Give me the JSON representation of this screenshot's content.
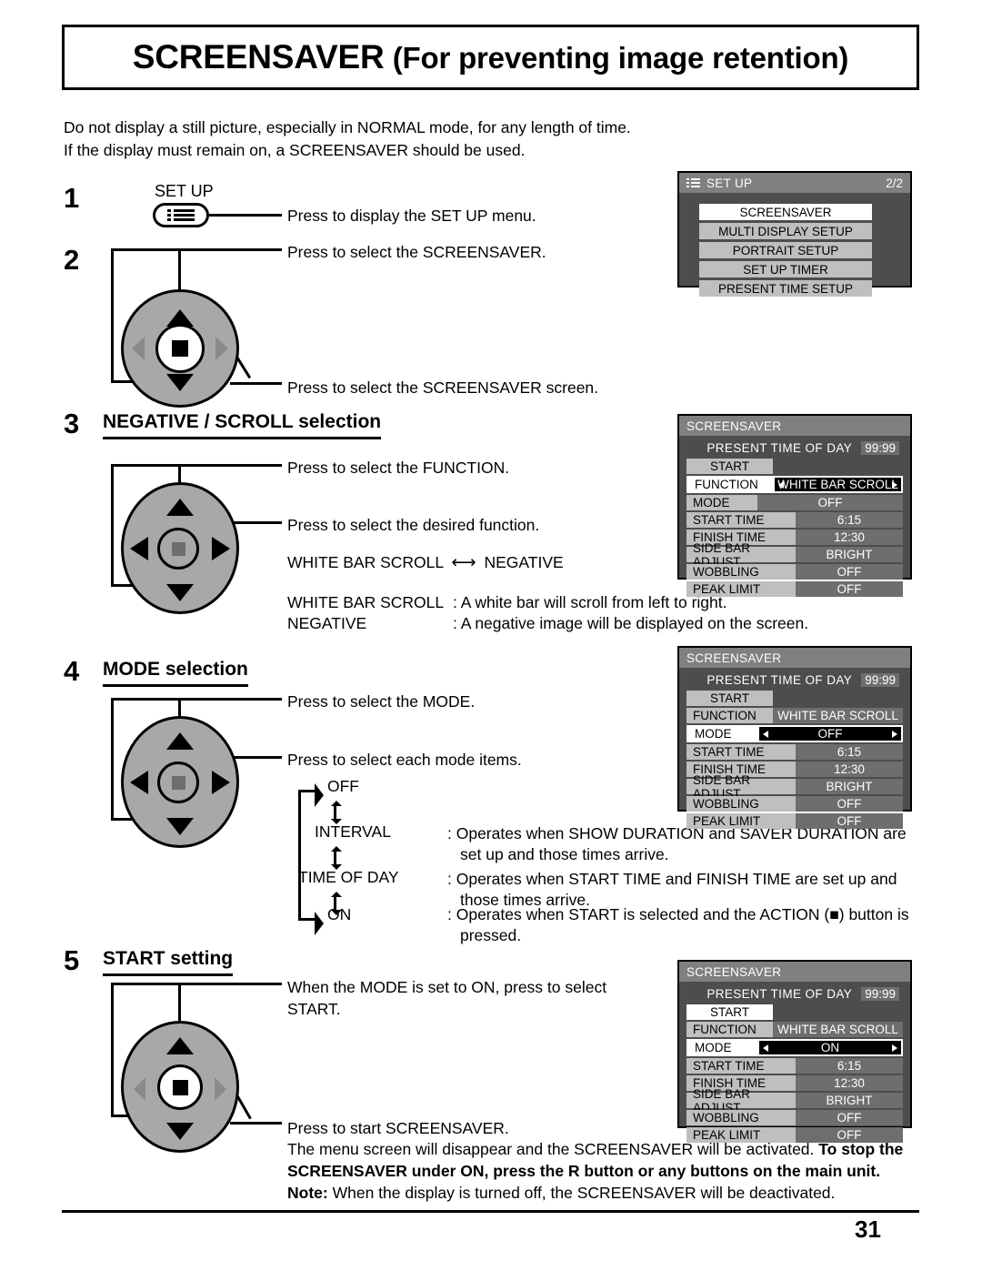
{
  "page": {
    "title_main": "SCREENSAVER",
    "title_sub": "(For preventing image retention)",
    "page_number": "31",
    "intro_line1": "Do not display a still picture, especially in NORMAL mode, for any length of time.",
    "intro_line2": "If the display must remain on, a SCREENSAVER should be used."
  },
  "steps": {
    "s1": {
      "num": "1",
      "button_label": "SET UP",
      "instruction": "Press to display the SET UP menu."
    },
    "s2": {
      "num": "2",
      "instruction_up": "Press to select the SCREENSAVER.",
      "instruction_action": "Press to select the SCREENSAVER screen."
    },
    "s3": {
      "num": "3",
      "heading": "NEGATIVE / SCROLL selection",
      "instruction_updown": "Press to select the FUNCTION.",
      "instruction_leftright": "Press to select the desired function.",
      "toggle_left": "WHITE BAR SCROLL",
      "toggle_right": "NEGATIVE",
      "desc": [
        {
          "term": "WHITE BAR SCROLL",
          "text": ": A white bar will scroll from left to right."
        },
        {
          "term": "NEGATIVE",
          "text": ": A negative image will be displayed on the screen."
        }
      ]
    },
    "s4": {
      "num": "4",
      "heading": "MODE selection",
      "instruction_updown": "Press to select the MODE.",
      "instruction_leftright": "Press to select each mode items.",
      "cycle": [
        {
          "name": "OFF",
          "text": ""
        },
        {
          "name": "INTERVAL",
          "text": ": Operates when SHOW DURATION and SAVER DURATION are",
          "text2": "set up and those times arrive."
        },
        {
          "name": "TIME OF DAY",
          "text": ": Operates when START TIME and FINISH TIME are set up and",
          "text2": "those times arrive."
        },
        {
          "name": "ON",
          "text": ": Operates when START is selected and the ACTION (■) button is",
          "text2": "pressed."
        }
      ]
    },
    "s5": {
      "num": "5",
      "heading": "START setting",
      "instruction_up_line1": "When the MODE is set to ON, press to select",
      "instruction_up_line2": "START.",
      "instruction_action": "Press to start SCREENSAVER.",
      "outro_plain1": "The menu screen will disappear and the SCREENSAVER will be activated. ",
      "outro_bold1": "To stop the",
      "outro_bold2": "SCREENSAVER under ON, press the R button or any buttons on the main unit.",
      "note_label": "Note:",
      "note_text": " When the display is turned off, the SCREENSAVER will be deactivated."
    }
  },
  "osd_setup": {
    "icon": "menu-list-icon",
    "title": "SET UP",
    "page_indicator": "2/2",
    "items": [
      {
        "label": "SCREENSAVER",
        "selected": true
      },
      {
        "label": "MULTI DISPLAY SETUP",
        "selected": false
      },
      {
        "label": "PORTRAIT SETUP",
        "selected": false
      },
      {
        "label": "SET UP TIMER",
        "selected": false
      },
      {
        "label": "PRESENT TIME SETUP",
        "selected": false
      }
    ]
  },
  "osd_screensaver": {
    "title": "SCREENSAVER",
    "present_label": "PRESENT  TIME OF DAY",
    "present_value": "99:99",
    "start_label": "START",
    "rows": [
      {
        "key": "FUNCTION",
        "value": "WHITE BAR SCROLL"
      },
      {
        "key": "MODE",
        "value": "OFF"
      },
      {
        "key": "START TIME",
        "value": "6:15"
      },
      {
        "key": "FINISH TIME",
        "value": "12:30"
      },
      {
        "key": "SIDE BAR ADJUST",
        "value": "BRIGHT"
      },
      {
        "key": "WOBBLING",
        "value": "OFF"
      },
      {
        "key": "PEAK LIMIT",
        "value": "OFF"
      }
    ],
    "panel3_highlight": "FUNCTION",
    "panel4_highlight": "MODE",
    "panel4_mode_value": "OFF",
    "panel5_highlight": "MODE",
    "panel5_mode_value": "ON",
    "panel5_start_selected": true
  },
  "colors": {
    "osd_header": "#808080",
    "osd_body": "#4d4d4d",
    "osd_label": "#bfbfbf",
    "osd_value": "#6e6e6e",
    "highlight": "#ffffff",
    "dpad": "#a8a8a8"
  }
}
